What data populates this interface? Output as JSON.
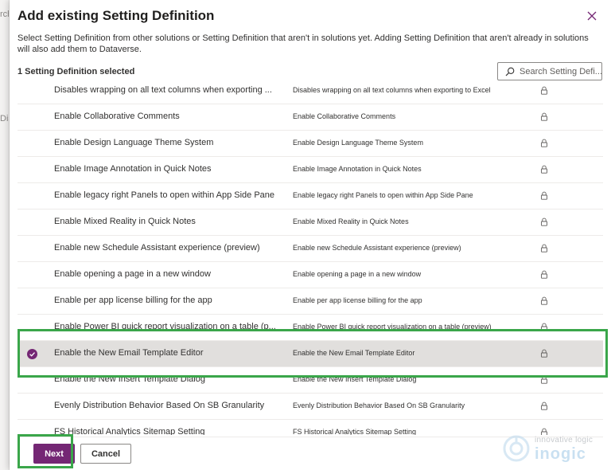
{
  "background": {
    "fragments": [
      "rch",
      "Dis"
    ]
  },
  "dialog": {
    "title": "Add existing Setting Definition",
    "description": "Select Setting Definition from other solutions or Setting Definition that aren't in solutions yet. Adding Setting Definition that aren't already in solutions will also add them to Dataverse.",
    "selected_count": "1 Setting Definition selected",
    "search": {
      "placeholder": "Search Setting Defi..."
    },
    "rows": [
      {
        "name": "Disables wrapping on all text columns when exporting ...",
        "display_name": "Disables wrapping on all text columns when exporting to Excel",
        "selected": false
      },
      {
        "name": "Enable Collaborative Comments",
        "display_name": "Enable Collaborative Comments",
        "selected": false
      },
      {
        "name": "Enable Design Language Theme System",
        "display_name": "Enable Design Language Theme System",
        "selected": false
      },
      {
        "name": "Enable Image Annotation in Quick Notes",
        "display_name": "Enable Image Annotation in Quick Notes",
        "selected": false
      },
      {
        "name": "Enable legacy right Panels to open within App Side Pane",
        "display_name": "Enable legacy right Panels to open within App Side Pane",
        "selected": false
      },
      {
        "name": "Enable Mixed Reality in Quick Notes",
        "display_name": "Enable Mixed Reality in Quick Notes",
        "selected": false
      },
      {
        "name": "Enable new Schedule Assistant experience (preview)",
        "display_name": "Enable new Schedule Assistant experience (preview)",
        "selected": false
      },
      {
        "name": "Enable opening a page in a new window",
        "display_name": "Enable opening a page in a new window",
        "selected": false
      },
      {
        "name": "Enable per app license billing for the app",
        "display_name": "Enable per app license billing for the app",
        "selected": false
      },
      {
        "name": "Enable Power BI quick report visualization on a table (p...",
        "display_name": "Enable Power BI quick report visualization on a table (preview)",
        "selected": false
      },
      {
        "name": "Enable the New Email Template Editor",
        "display_name": "Enable the New Email Template Editor",
        "selected": true
      },
      {
        "name": "Enable the New Insert Template Dialog",
        "display_name": "Enable the New Insert Template Dialog",
        "selected": false
      },
      {
        "name": "Evenly Distribution Behavior Based On SB Granularity",
        "display_name": "Evenly Distribution Behavior Based On SB Granularity",
        "selected": false
      },
      {
        "name": "FS Historical Analytics Sitemap Setting",
        "display_name": "FS Historical Analytics Sitemap Setting",
        "selected": false
      }
    ],
    "buttons": {
      "next": "Next",
      "cancel": "Cancel"
    }
  },
  "watermark": {
    "tagline": "innovative logic",
    "brand": "inogic"
  },
  "colors": {
    "primary": "#742774",
    "highlight": "#3aa64a",
    "selected_row": "#e1dfdd"
  },
  "icons": {
    "close": "close-icon",
    "search": "search-icon",
    "lock": "lock-icon",
    "check": "check-circle-icon"
  }
}
